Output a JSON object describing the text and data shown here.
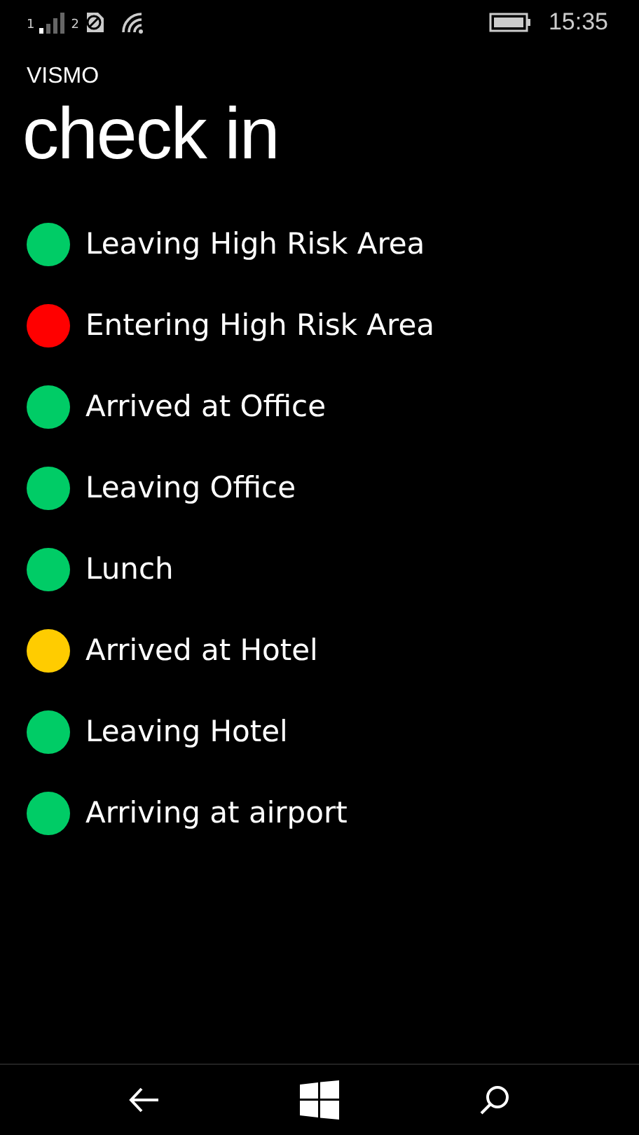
{
  "status_bar": {
    "sim_1": "1",
    "sim_2": "2",
    "time": "15:35"
  },
  "app_title": "VISMO",
  "page_title": "check in",
  "items": [
    {
      "label": "Leaving High Risk Area",
      "color": "#00cc66"
    },
    {
      "label": "Entering High Risk Area",
      "color": "#ff0000"
    },
    {
      "label": "Arrived at Office",
      "color": "#00cc66"
    },
    {
      "label": "Leaving Office",
      "color": "#00cc66"
    },
    {
      "label": "Lunch",
      "color": "#00cc66"
    },
    {
      "label": "Arrived at Hotel",
      "color": "#ffcc00"
    },
    {
      "label": "Leaving Hotel",
      "color": "#00cc66"
    },
    {
      "label": "Arriving at airport",
      "color": "#00cc66"
    }
  ]
}
